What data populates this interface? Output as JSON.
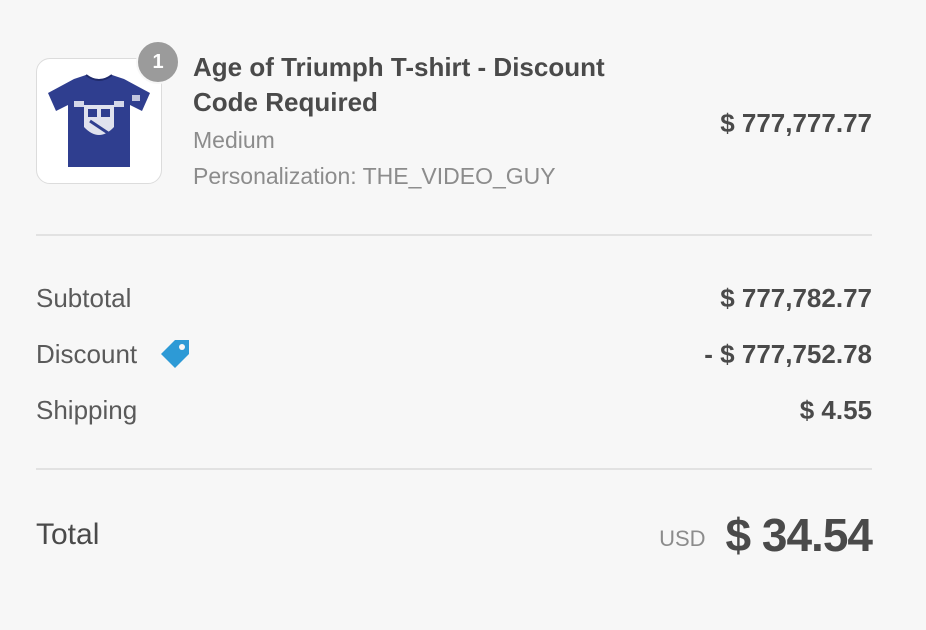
{
  "product": {
    "quantity": "1",
    "title": "Age of Triumph T-shirt - Discount Code Required",
    "variant": "Medium",
    "personalization": "Personalization: THE_VIDEO_GUY",
    "price": "$ 777,777.77",
    "image_icon": "t-shirt-image",
    "shirt_color": "#2f3e8f"
  },
  "lines": {
    "subtotal_label": "Subtotal",
    "subtotal_value": "$ 777,782.77",
    "discount_label": "Discount",
    "discount_value": "- $ 777,752.78",
    "discount_icon": "tag-icon",
    "tag_color": "#2d9ad6",
    "shipping_label": "Shipping",
    "shipping_value": "$ 4.55"
  },
  "total": {
    "label": "Total",
    "currency": "USD",
    "value": "$ 34.54"
  }
}
